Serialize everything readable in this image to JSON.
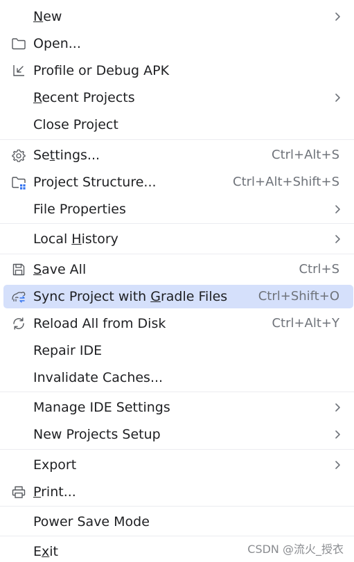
{
  "menu": {
    "items": [
      {
        "label": "New",
        "mnemonic_index": 0,
        "shortcut": "",
        "submenu": true,
        "icon": ""
      },
      {
        "label": "Open...",
        "mnemonic_index": -1,
        "shortcut": "",
        "submenu": false,
        "icon": "folder-icon"
      },
      {
        "label": "Profile or Debug APK",
        "mnemonic_index": -1,
        "shortcut": "",
        "submenu": false,
        "icon": "import-arrow-icon"
      },
      {
        "label": "Recent Projects",
        "mnemonic_index": 0,
        "shortcut": "",
        "submenu": true,
        "icon": ""
      },
      {
        "label": "Close Project",
        "mnemonic_index": 9,
        "shortcut": "",
        "submenu": false,
        "icon": ""
      },
      {
        "label": "Settings...",
        "mnemonic_index": 2,
        "shortcut": "Ctrl+Alt+S",
        "submenu": false,
        "icon": "gear-icon"
      },
      {
        "label": "Project Structure...",
        "mnemonic_index": -1,
        "shortcut": "Ctrl+Alt+Shift+S",
        "submenu": false,
        "icon": "project-structure-icon"
      },
      {
        "label": "File Properties",
        "mnemonic_index": -1,
        "shortcut": "",
        "submenu": true,
        "icon": ""
      },
      {
        "label": "Local History",
        "mnemonic_index": 6,
        "shortcut": "",
        "submenu": true,
        "icon": ""
      },
      {
        "label": "Save All",
        "mnemonic_index": 0,
        "shortcut": "Ctrl+S",
        "submenu": false,
        "icon": "save-icon"
      },
      {
        "label": "Sync Project with Gradle Files",
        "mnemonic_index": 18,
        "shortcut": "Ctrl+Shift+O",
        "submenu": false,
        "icon": "gradle-sync-icon",
        "selected": true
      },
      {
        "label": "Reload All from Disk",
        "mnemonic_index": -1,
        "shortcut": "Ctrl+Alt+Y",
        "submenu": false,
        "icon": "reload-icon"
      },
      {
        "label": "Repair IDE",
        "mnemonic_index": -1,
        "shortcut": "",
        "submenu": false,
        "icon": ""
      },
      {
        "label": "Invalidate Caches...",
        "mnemonic_index": -1,
        "shortcut": "",
        "submenu": false,
        "icon": ""
      },
      {
        "label": "Manage IDE Settings",
        "mnemonic_index": -1,
        "shortcut": "",
        "submenu": true,
        "icon": ""
      },
      {
        "label": "New Projects Setup",
        "mnemonic_index": -1,
        "shortcut": "",
        "submenu": true,
        "icon": ""
      },
      {
        "label": "Export",
        "mnemonic_index": -1,
        "shortcut": "",
        "submenu": true,
        "icon": ""
      },
      {
        "label": "Print...",
        "mnemonic_index": 0,
        "shortcut": "",
        "submenu": false,
        "icon": "print-icon"
      },
      {
        "label": "Power Save Mode",
        "mnemonic_index": -1,
        "shortcut": "",
        "submenu": false,
        "icon": ""
      },
      {
        "label": "Exit",
        "mnemonic_index": 1,
        "shortcut": "",
        "submenu": false,
        "icon": ""
      }
    ]
  },
  "watermark": "CSDN @流火_授衣",
  "colors": {
    "selected_background": "#d5e0fb",
    "shortcut_text": "#6f737a",
    "separator": "#ebecf0",
    "icon_blue": "#3574f0"
  }
}
